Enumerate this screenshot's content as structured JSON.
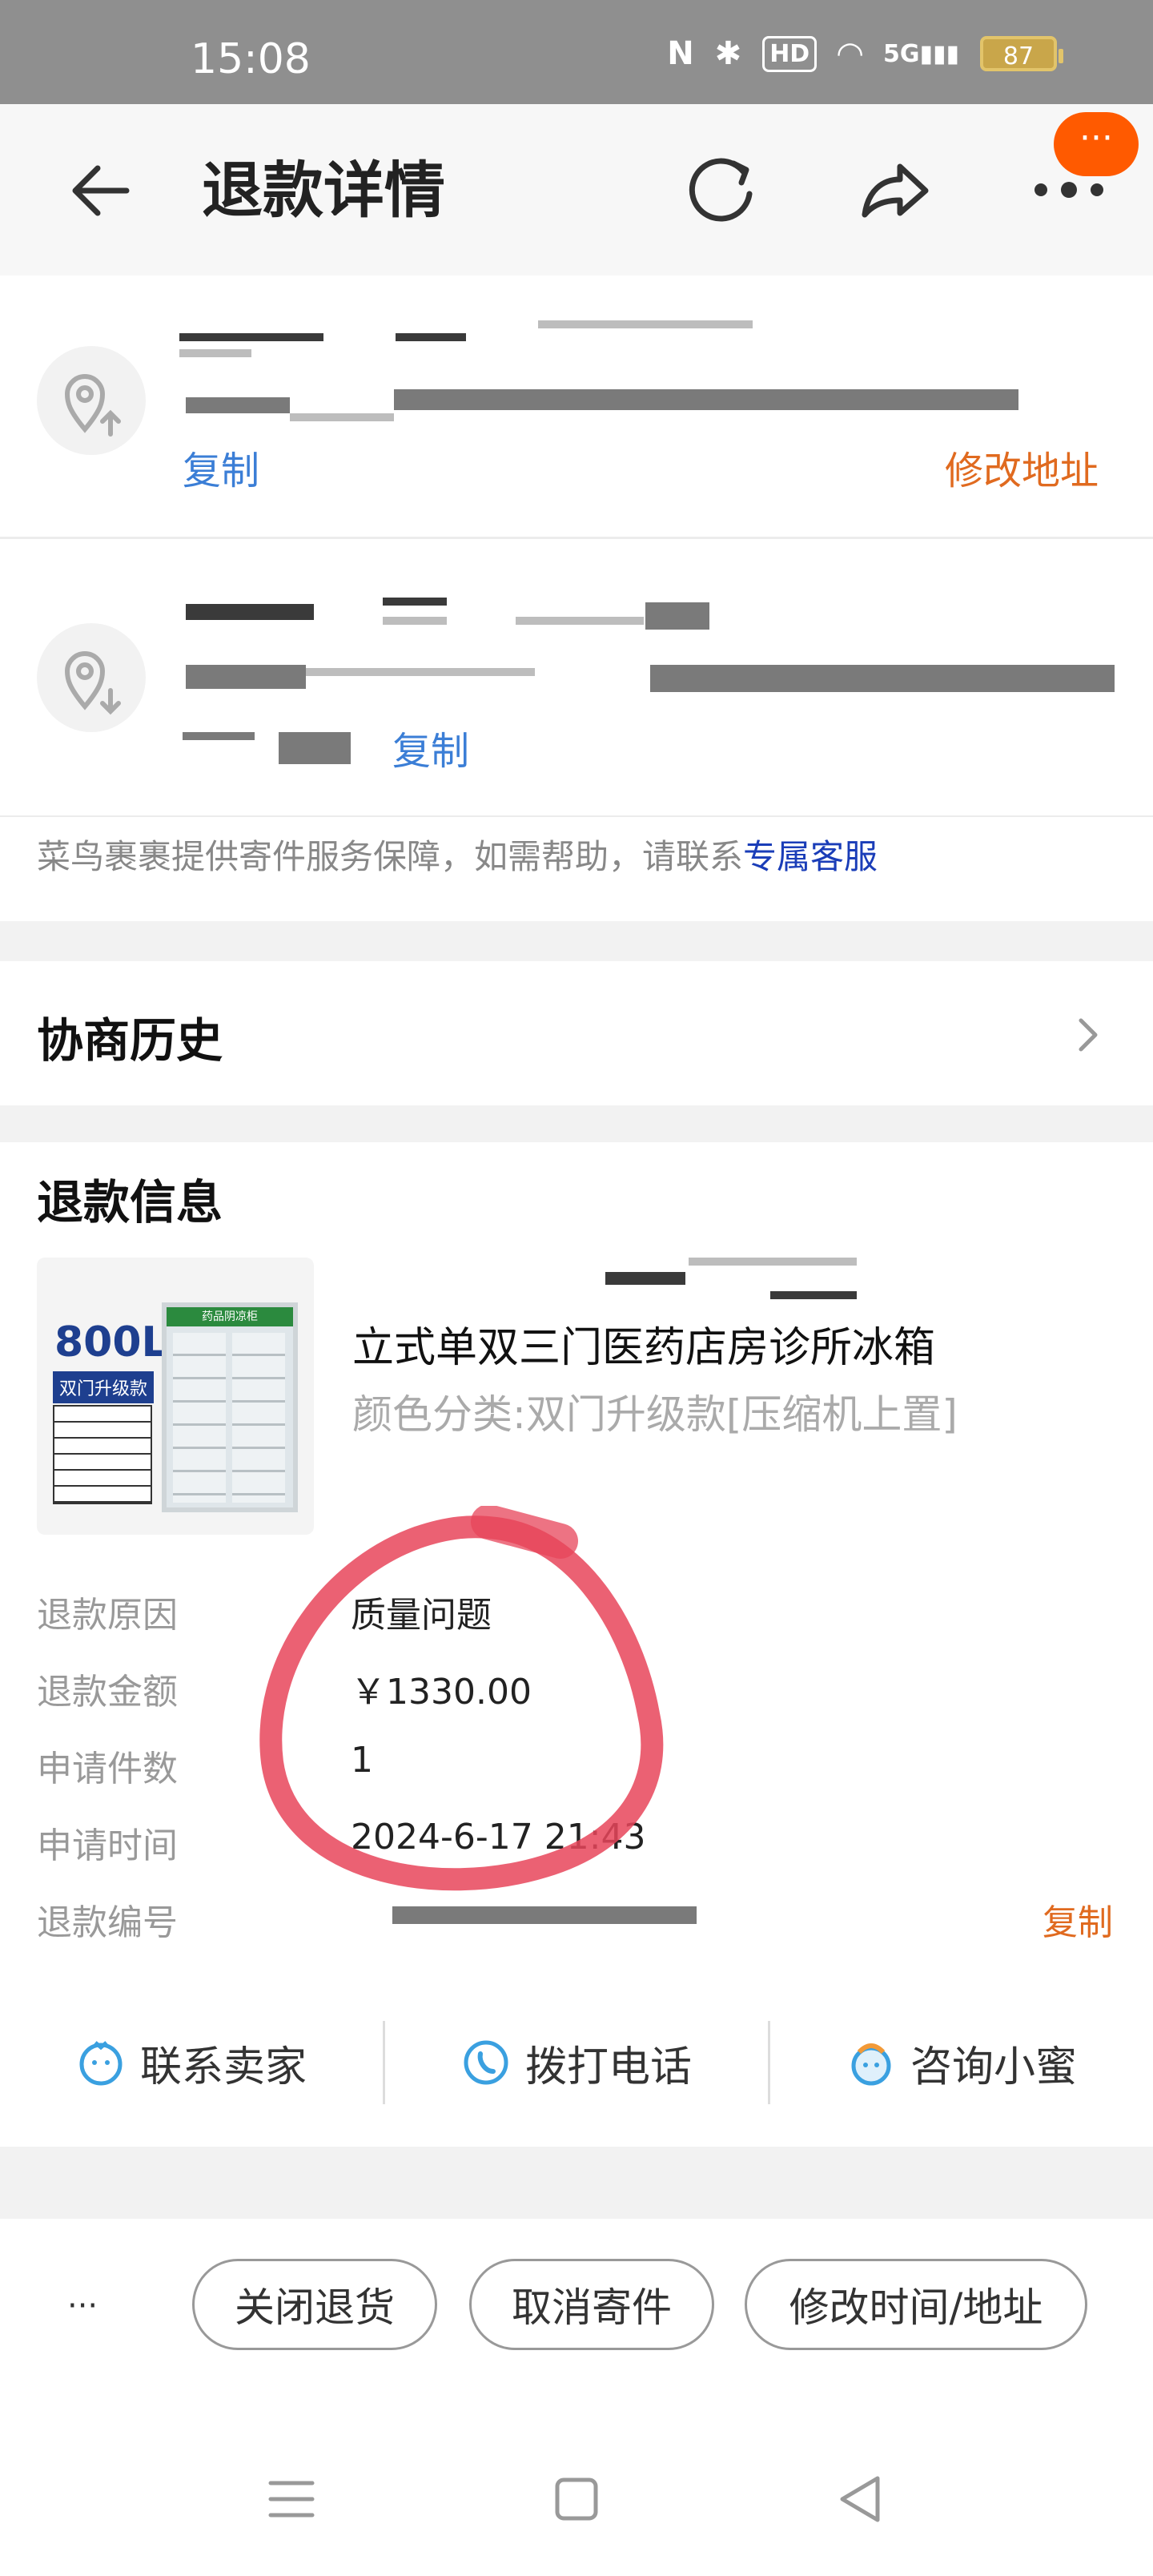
{
  "status_bar": {
    "time": "15:08",
    "nfc": "N",
    "network": "5G",
    "battery": "87"
  },
  "header": {
    "title": "退款详情"
  },
  "more_badge": "···",
  "addresses": {
    "copy_label": "复制",
    "modify_label": "修改地址"
  },
  "notice": {
    "text": "菜鸟裹裹提供寄件服务保障，如需帮助，请联系",
    "link": "专属客服"
  },
  "history": {
    "title": "协商历史"
  },
  "refund_info": {
    "title": "退款信息",
    "product": {
      "image_capacity": "800L",
      "image_badge": "双门升级款",
      "image_brand": "药品阴凉柜",
      "name": "立式单双三门医药店房诊所冰箱",
      "sku": "颜色分类:双门升级款[压缩机上置]"
    },
    "rows": [
      {
        "label": "退款原因",
        "value": "质量问题"
      },
      {
        "label": "退款金额",
        "value": "￥1330.00"
      },
      {
        "label": "申请件数",
        "value": "1"
      },
      {
        "label": "申请时间",
        "value": "2024-6-17 21:43"
      },
      {
        "label": "退款编号",
        "value": ""
      }
    ],
    "copy_label": "复制"
  },
  "actions": [
    {
      "label": "联系卖家",
      "icon": "chat-face-icon"
    },
    {
      "label": "拨打电话",
      "icon": "phone-icon"
    },
    {
      "label": "咨询小蜜",
      "icon": "assistant-icon"
    }
  ],
  "bottom": {
    "more": "···",
    "buttons": [
      "关闭退货",
      "取消寄件",
      "修改时间/地址"
    ]
  },
  "colors": {
    "accent_orange": "#e06a1f",
    "link_blue": "#3b7ed6",
    "badge_orange": "#ff5a00",
    "annotation_red": "#e8455a"
  }
}
